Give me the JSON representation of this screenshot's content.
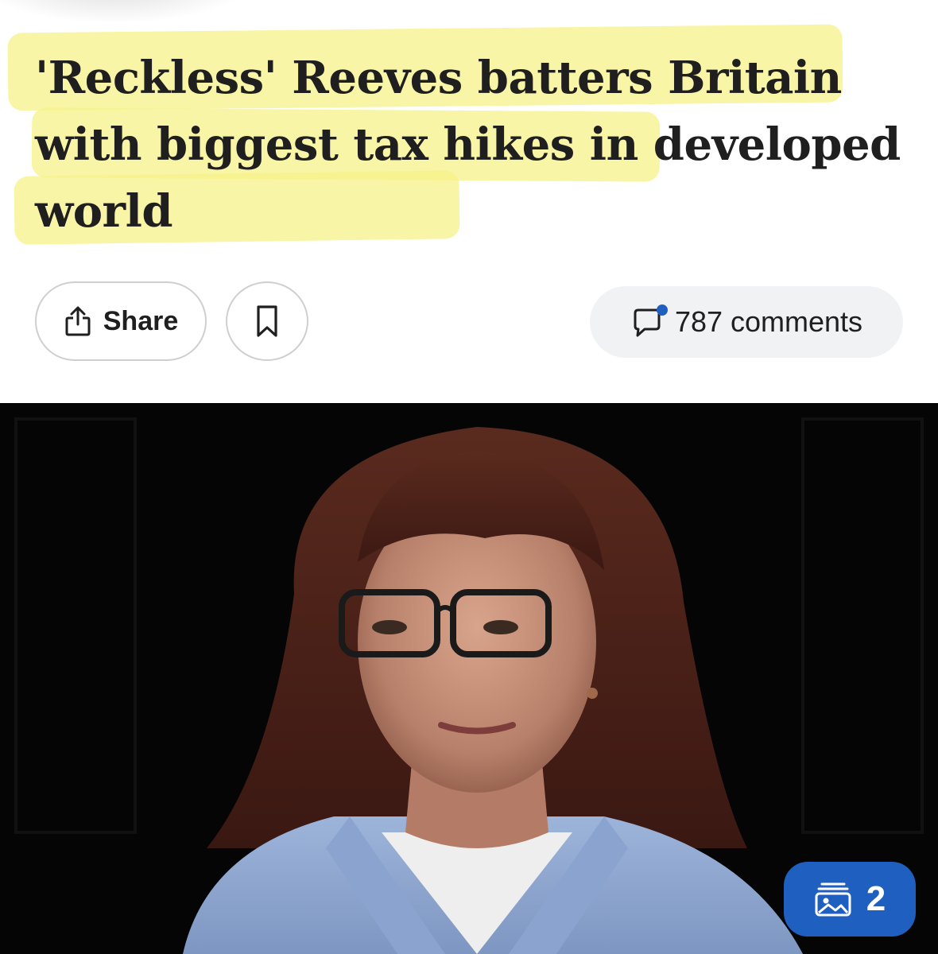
{
  "article": {
    "headline": "'Reckless' Reeves batters Britain with biggest tax hikes in developed world"
  },
  "actions": {
    "share_label": "Share",
    "share_icon": "share-icon",
    "bookmark_icon": "bookmark-icon",
    "comments_label": "787 comments",
    "comments_icon": "comment-icon"
  },
  "photo": {
    "gallery_icon": "gallery-icon",
    "gallery_count": "2"
  },
  "colors": {
    "highlight": "#f7f28a",
    "accent_blue": "#1f5fbf",
    "notification_dot": "#1f5fbf"
  }
}
